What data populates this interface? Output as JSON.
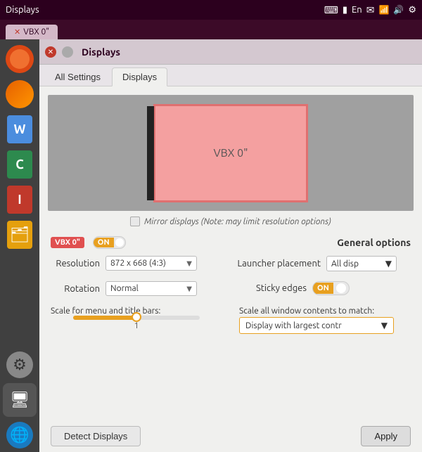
{
  "taskbar": {
    "title": "Displays",
    "icons": [
      "keyboard-icon",
      "battery-icon",
      "lang-icon",
      "mail-icon",
      "network-icon",
      "volume-icon",
      "power-icon"
    ],
    "lang": "En"
  },
  "window_tab": {
    "label": "VBX 0\""
  },
  "titlebar": {
    "title": "Displays"
  },
  "tabs": {
    "all_settings": "All Settings",
    "displays": "Displays"
  },
  "monitor": {
    "label": "VBX 0\""
  },
  "mirror": {
    "label": "Mirror displays",
    "note": "(Note: may limit resolution options)"
  },
  "display_select": {
    "badge": "VBX 0\"",
    "toggle": "ON"
  },
  "resolution": {
    "label": "Resolution",
    "value": "872 x 668 (4:3)"
  },
  "rotation": {
    "label": "Rotation",
    "value": "Normal"
  },
  "general_options": {
    "title": "General options",
    "launcher_placement": {
      "label": "Launcher placement",
      "value": "All disp"
    },
    "sticky_edges": {
      "label": "Sticky edges",
      "toggle": "ON"
    }
  },
  "scale_menu": {
    "label": "Scale for menu and title bars:",
    "value": "1"
  },
  "scale_window": {
    "label": "Scale all window contents to match:",
    "value": "Display with largest contr"
  },
  "buttons": {
    "detect": "Detect Displays",
    "apply": "Apply"
  }
}
